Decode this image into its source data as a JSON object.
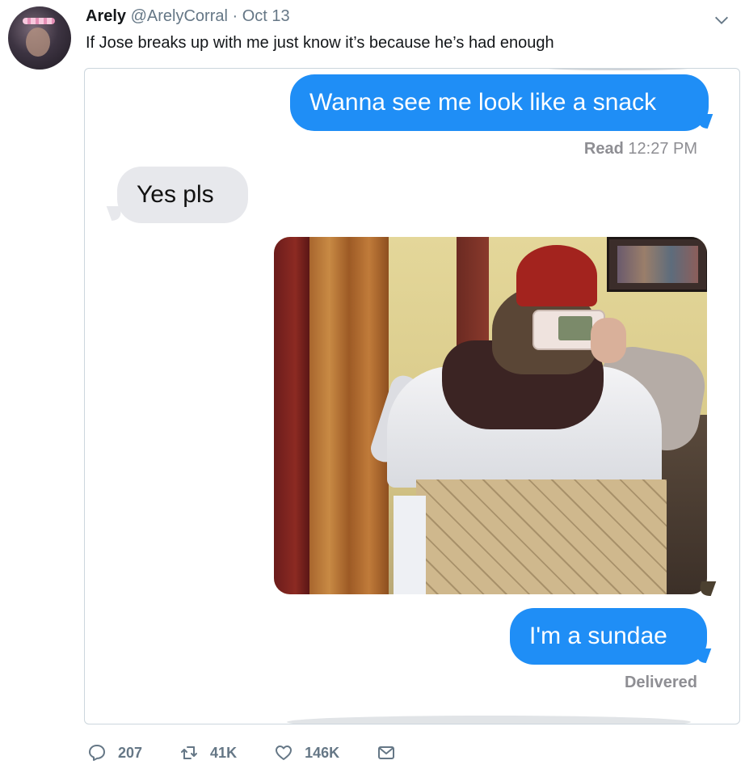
{
  "tweet": {
    "author_name": "Arely",
    "handle": "@ArelyCorral",
    "separator": "·",
    "date": "Oct 13",
    "text": "If Jose breaks up with me just know it’s because he’s had enough"
  },
  "messages": {
    "outgoing_1": "Wanna see me look like a snack",
    "read_label": "Read",
    "read_time": "12:27 PM",
    "incoming_1": "Yes pls",
    "outgoing_2": "I'm a sundae",
    "delivered": "Delivered"
  },
  "actions": {
    "replies": "207",
    "retweets": "41K",
    "likes": "146K"
  },
  "icons": {
    "reply": "reply-icon",
    "retweet": "retweet-icon",
    "like": "heart-icon",
    "dm": "envelope-icon",
    "menu": "chevron-down-icon"
  },
  "colors": {
    "imessage_blue": "#1f8ef6",
    "imessage_gray": "#e7e8ec",
    "muted": "#657786"
  }
}
